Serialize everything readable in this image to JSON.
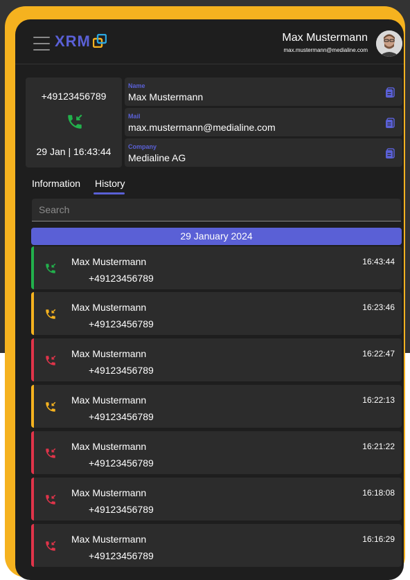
{
  "header": {
    "logo_text": "XRM",
    "user_name": "Max Mustermann",
    "user_email": "max.mustermann@medialine.com"
  },
  "caller": {
    "number": "+49123456789",
    "datetime": "29 Jan | 16:43:44",
    "status_color": "#22b14c"
  },
  "fields": {
    "name_label": "Name",
    "name_value": "Max Mustermann",
    "mail_label": "Mail",
    "mail_value": "max.mustermann@medialine.com",
    "company_label": "Company",
    "company_value": "Medialine AG"
  },
  "tabs": {
    "information": "Information",
    "history": "History",
    "active": "history"
  },
  "search": {
    "placeholder": "Search",
    "value": ""
  },
  "history": {
    "date_header": "29 January 2024",
    "entries": [
      {
        "name": "Max Mustermann",
        "number": "+49123456789",
        "time": "16:43:44",
        "status": "answered",
        "color": "#22b14c",
        "icon": "phone-incoming-icon"
      },
      {
        "name": "Max Mustermann",
        "number": "+49123456789",
        "time": "16:23:46",
        "status": "pending",
        "color": "#f5b21f",
        "icon": "phone-incoming-icon"
      },
      {
        "name": "Max Mustermann",
        "number": "+49123456789",
        "time": "16:22:47",
        "status": "missed",
        "color": "#e0344a",
        "icon": "phone-incoming-icon"
      },
      {
        "name": "Max Mustermann",
        "number": "+49123456789",
        "time": "16:22:13",
        "status": "pending",
        "color": "#f5b21f",
        "icon": "phone-incoming-icon"
      },
      {
        "name": "Max Mustermann",
        "number": "+49123456789",
        "time": "16:21:22",
        "status": "missed",
        "color": "#e0344a",
        "icon": "phone-incoming-icon"
      },
      {
        "name": "Max Mustermann",
        "number": "+49123456789",
        "time": "16:18:08",
        "status": "missed",
        "color": "#e0344a",
        "icon": "phone-incoming-icon"
      },
      {
        "name": "Max Mustermann",
        "number": "+49123456789",
        "time": "16:16:29",
        "status": "missed",
        "color": "#e0344a",
        "icon": "phone-incoming-icon"
      }
    ]
  },
  "colors": {
    "accent": "#5a60d6",
    "frame": "#f5b21f",
    "background": "#1e1e1e",
    "panel": "#2c2c2c"
  }
}
